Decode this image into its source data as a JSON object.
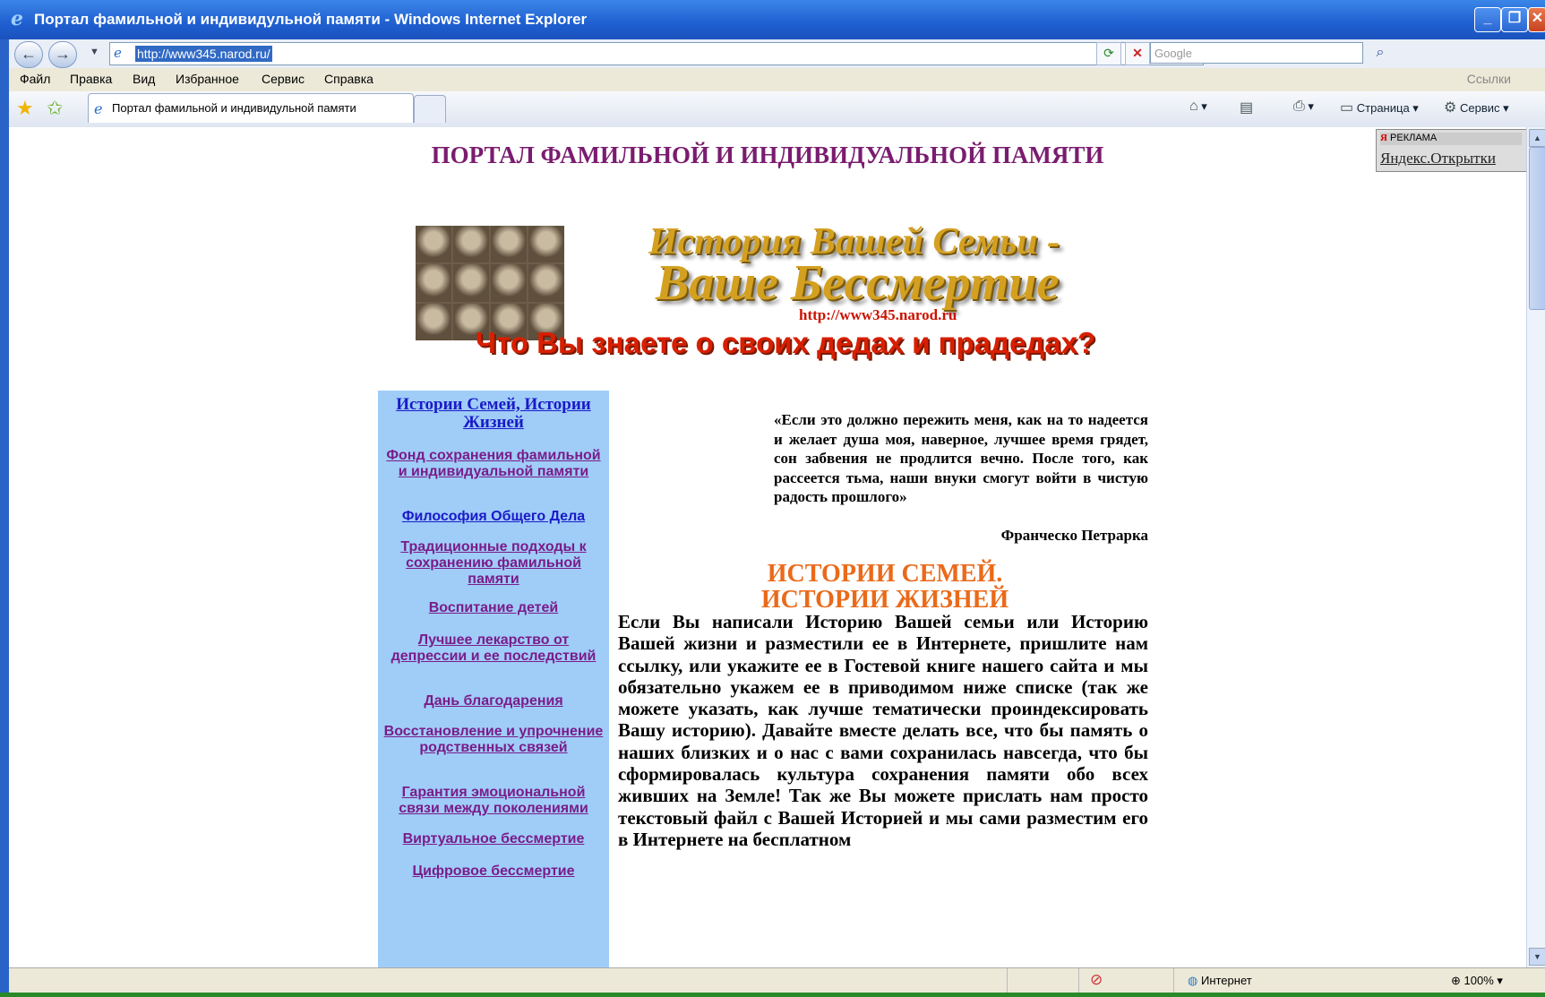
{
  "window": {
    "title": "Портал фамильной и индивидульной памяти - Windows Internet Explorer",
    "minimize": "_",
    "maximize": "❐",
    "close": "✕"
  },
  "address": {
    "url": "http://www345.narod.ru/",
    "search_placeholder": "Google"
  },
  "menu": {
    "items": [
      "Файл",
      "Правка",
      "Вид",
      "Избранное",
      "Сервис",
      "Справка"
    ],
    "links": "Ссылки"
  },
  "tabs": {
    "active_label": "Портал фамильной и индивидульной памяти"
  },
  "command_bar": {
    "page": "Страница",
    "tools": "Сервис"
  },
  "ad": {
    "label": "РЕКЛАМА",
    "logo": "Я",
    "text": "Яндекс.Открытки"
  },
  "page": {
    "portal_title": "ПОРТАЛ ФАМИЛЬНОЙ И ИНДИВИДУАЛЬНОЙ ПАМЯТИ",
    "banner_line1": "История Вашей Семьи -",
    "banner_line2": "Ваше Бессмертие",
    "banner_url": "http://www345.narod.ru",
    "question": "Что Вы знаете о своих дедах и прадедах?",
    "sidebar": [
      "Истории Семей, Истории Жизней",
      "Фонд сохранения фамильной и индивидуальной памяти",
      "Философия Общего Дела",
      "Традиционные подходы к сохранению фамильной памяти",
      "Воспитание детей",
      "Лучшее лекарство от депрессии и ее последствий",
      "Дань благодарения",
      "Восстановление и упрочнение родственных связей",
      "Гарантия эмоциональной связи между поколениями",
      "Виртуальное бессмертие",
      "Цифровое бессмертие"
    ],
    "quote": "«Если это должно пережить меня, как на то надеется и желает душа моя, наверное, лучшее время грядет, сон забвения не продлится вечно. После того, как рассеется тьма, наши внуки смогут войти в чистую радость прошлого»",
    "quote_author": "Франческо Петрарка",
    "section_title_1": "ИСТОРИИ СЕМЕЙ.",
    "section_title_2": "ИСТОРИИ ЖИЗНЕЙ",
    "body": "Если Вы написали Историю Вашей семьи или Историю Вашей жизни и разместили ее в Интернете, пришлите нам ссылку, или укажите ее в Гостевой книге нашего сайта и мы обязательно укажем ее в приводимом ниже списке (так же можете указать, как лучше тематически проиндексировать Вашу историю). Давайте вместе делать все, что бы память о наших близких и о нас с вами сохранилась навсегда, что бы сформировалась культура сохранения памяти обо всех живших на Земле! Так же Вы можете прислать нам просто текстовый файл с Вашей Историей и мы сами разместим его в Интернете на бесплатном"
  },
  "status": {
    "zone": "Интернет",
    "zoom": "100%"
  },
  "colors": {
    "titlebar": "#1f5fd0",
    "portal_title": "#7a1c6f",
    "sidebar_bg": "#9fcdf8",
    "section_title": "#ea6a1a",
    "question": "#d81f00"
  }
}
